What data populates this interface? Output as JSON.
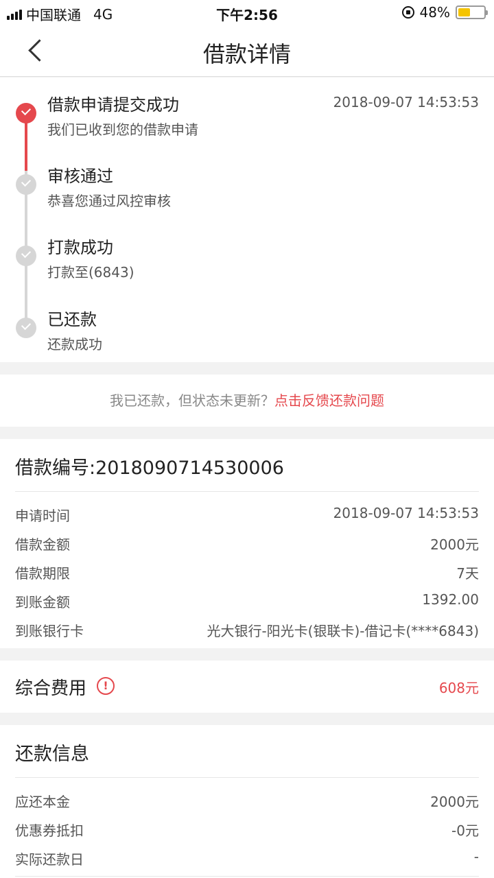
{
  "status_bar": {
    "carrier": "中国联通",
    "network": "4G",
    "time": "下午2:56",
    "battery": "48%",
    "battery_level": 0.48
  },
  "nav": {
    "title": "借款详情"
  },
  "progress": {
    "steps": [
      {
        "title": "借款申请提交成功",
        "desc": "我们已收到您的借款申请",
        "time": "2018-09-07 14:53:53",
        "done": true
      },
      {
        "title": "审核通过",
        "desc": "恭喜您通过风控审核",
        "time": "",
        "done": false
      },
      {
        "title": "打款成功",
        "desc": "打款至(6843)",
        "time": "",
        "done": false
      },
      {
        "title": "已还款",
        "desc": "还款成功",
        "time": "",
        "done": false
      }
    ]
  },
  "feedback": {
    "prompt": "我已还款，但状态未更新？",
    "link": "点击反馈还款问题"
  },
  "loan": {
    "number_label": "借款编号:2018090714530006",
    "rows": [
      {
        "key": "申请时间",
        "value": "2018-09-07 14:53:53"
      },
      {
        "key": "借款金额",
        "value": "2000元"
      },
      {
        "key": "借款期限",
        "value": "7天"
      },
      {
        "key": "到账金额",
        "value": "1392.00"
      },
      {
        "key": "到账银行卡",
        "value": "光大银行-阳光卡(银联卡)-借记卡(****6843)"
      }
    ]
  },
  "fee": {
    "label": "综合费用",
    "icon": "!",
    "value": "608元"
  },
  "repay": {
    "title": "还款信息",
    "rows": [
      {
        "key": "应还本金",
        "value": "2000元"
      },
      {
        "key": "优惠券抵扣",
        "value": "-0元"
      },
      {
        "key": "实际还款日",
        "value": "-"
      }
    ]
  },
  "colors": {
    "accent": "#e5484d",
    "inactive": "#d6d6d6",
    "battery": "#f5c400"
  }
}
